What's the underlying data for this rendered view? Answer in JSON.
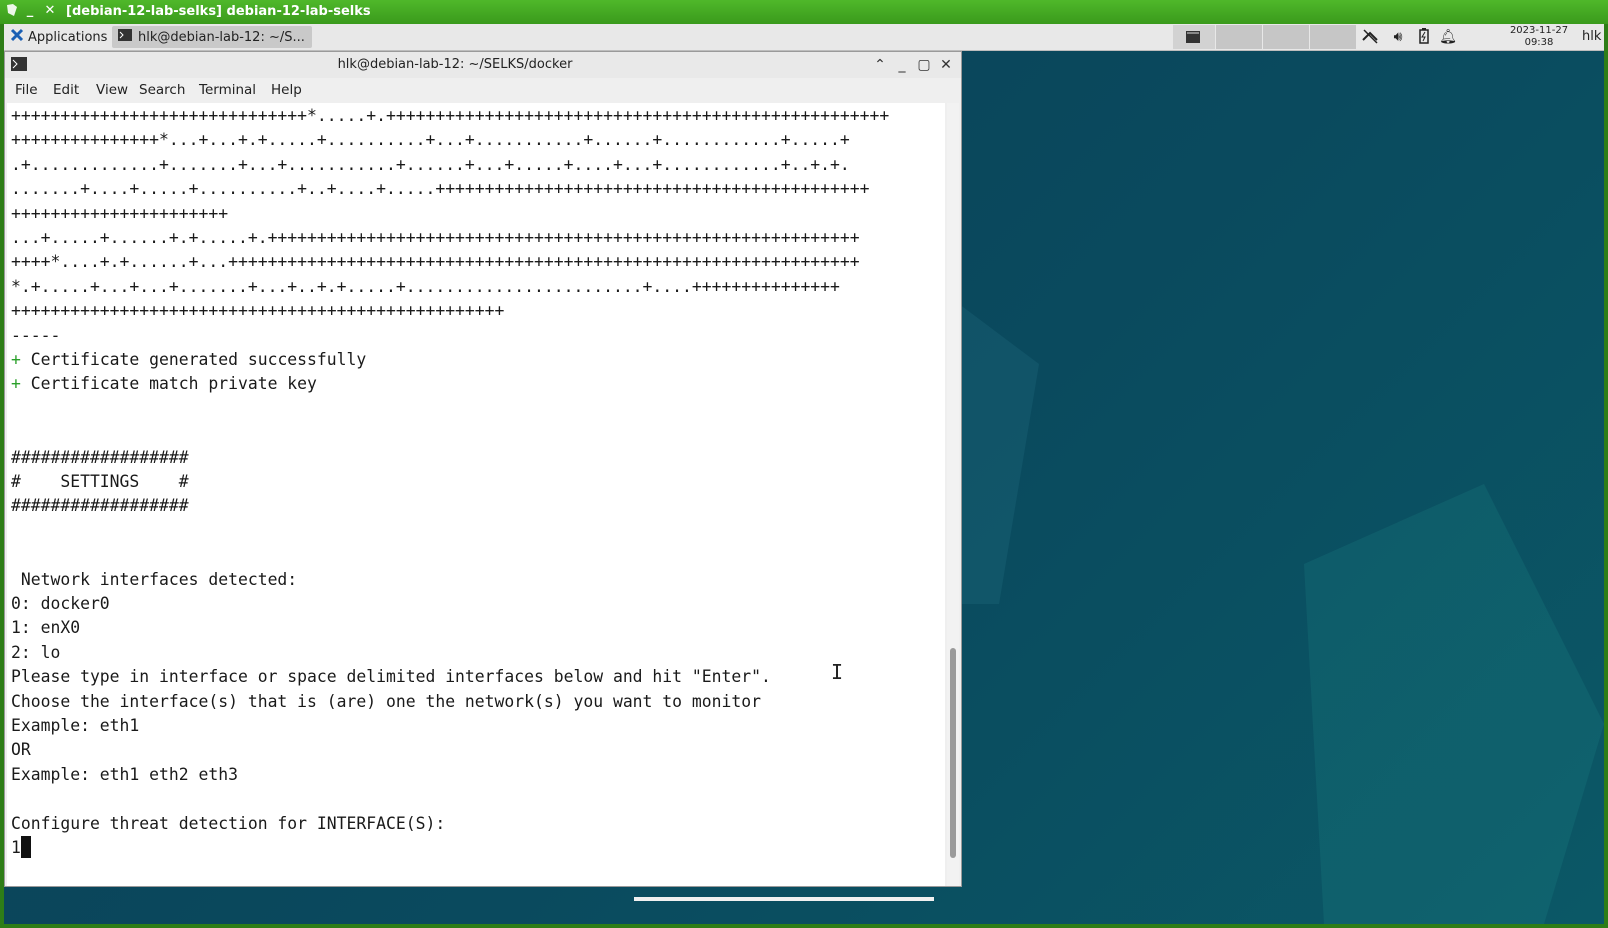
{
  "vm": {
    "title": "[debian-12-lab-selks] debian-12-lab-selks",
    "min_glyph": "_",
    "close_glyph": "✕"
  },
  "panel": {
    "applications_label": "Applications",
    "task_label": "hlk@debian-lab-12: ~/S...",
    "clock_date": "2023-11-27",
    "clock_time": "09:38",
    "user": "hlk"
  },
  "terminal": {
    "title": "hlk@debian-lab-12: ~/SELKS/docker",
    "menu": [
      "File",
      "Edit",
      "View",
      "Search",
      "Terminal",
      "Help"
    ],
    "lines": [
      {
        "text": "++++++++++++++++++++++++++++++*.....+.+++++++++++++++++++++++++++++++++++++++++++++++++++"
      },
      {
        "text": "+++++++++++++++*...+...+.+.....+..........+...+...........+......+............+.....+"
      },
      {
        "text": ".+.............+.......+...+...........+......+...+.....+....+...+............+..+.+."
      },
      {
        "text": ".......+....+.....+..........+..+....+.....++++++++++++++++++++++++++++++++++++++++++++"
      },
      {
        "text": "++++++++++++++++++++++"
      },
      {
        "text": "...+.....+......+.+.....+.++++++++++++++++++++++++++++++++++++++++++++++++++++++++++++"
      },
      {
        "text": "++++*....+.+......+...++++++++++++++++++++++++++++++++++++++++++++++++++++++++++++++++"
      },
      {
        "text": "*.+.....+...+...+.......+...+..+.+.....+........................+....+++++++++++++++"
      },
      {
        "text": "++++++++++++++++++++++++++++++++++++++++++++++++++"
      },
      {
        "text": "-----"
      },
      {
        "text": " Certificate generated successfully",
        "prefix": "+"
      },
      {
        "text": " Certificate match private key",
        "prefix": "+"
      },
      {
        "text": ""
      },
      {
        "text": ""
      },
      {
        "text": "##################"
      },
      {
        "text": "#    SETTINGS    #"
      },
      {
        "text": "##################"
      },
      {
        "text": ""
      },
      {
        "text": ""
      },
      {
        "text": " Network interfaces detected:"
      },
      {
        "text": "0: docker0"
      },
      {
        "text": "1: enX0"
      },
      {
        "text": "2: lo"
      },
      {
        "text": "Please type in interface or space delimited interfaces below and hit \"Enter\"."
      },
      {
        "text": "Choose the interface(s) that is (are) one the network(s) you want to monitor"
      },
      {
        "text": "Example: eth1"
      },
      {
        "text": "OR"
      },
      {
        "text": "Example: eth1 eth2 eth3"
      },
      {
        "text": ""
      },
      {
        "text": "Configure threat detection for INTERFACE(S):"
      },
      {
        "text": "1",
        "cursor": true
      }
    ]
  }
}
